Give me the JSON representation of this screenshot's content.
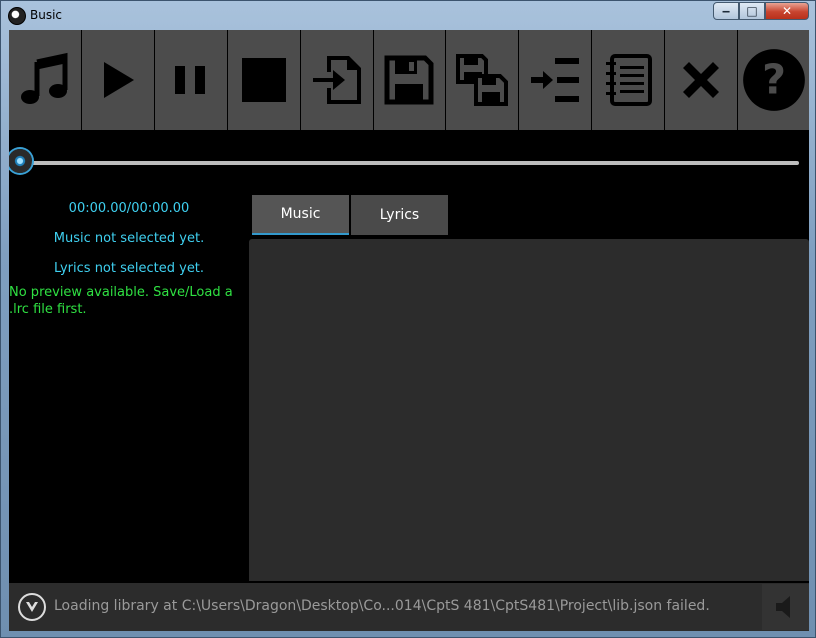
{
  "window": {
    "title": "Busic",
    "controls": {
      "minimize": "‒",
      "maximize": "□",
      "close": "✕"
    }
  },
  "toolbar": {
    "buttons": [
      {
        "name": "music-note-icon",
        "action": "open music"
      },
      {
        "name": "play-icon",
        "action": "play"
      },
      {
        "name": "pause-icon",
        "action": "pause"
      },
      {
        "name": "stop-icon",
        "action": "stop"
      },
      {
        "name": "import-file-icon",
        "action": "load"
      },
      {
        "name": "save-icon",
        "action": "save"
      },
      {
        "name": "save-as-icon",
        "action": "save as"
      },
      {
        "name": "insert-line-icon",
        "action": "insert"
      },
      {
        "name": "notebook-icon",
        "action": "lyrics editor"
      },
      {
        "name": "close-icon",
        "action": "delete"
      },
      {
        "name": "help-icon",
        "action": "help"
      }
    ]
  },
  "playback": {
    "time": "00:00.00/00:00.00",
    "progress": 0
  },
  "status": {
    "music": "Music not selected yet.",
    "lyrics": "Lyrics not selected yet.",
    "preview": "No preview available. Save/Load a .lrc file first."
  },
  "tabs": [
    {
      "label": "Music",
      "active": true
    },
    {
      "label": "Lyrics",
      "active": false
    }
  ],
  "statusbar": {
    "message": "Loading library at C:\\Users\\Dragon\\Desktop\\Co...014\\CptS 481\\CptS481\\Project\\lib.json failed."
  },
  "colors": {
    "accent": "#3fd0f0",
    "preview_text": "#2fe042",
    "button_bg": "#4c4c4c",
    "panel_bg": "#2c2c2c"
  }
}
